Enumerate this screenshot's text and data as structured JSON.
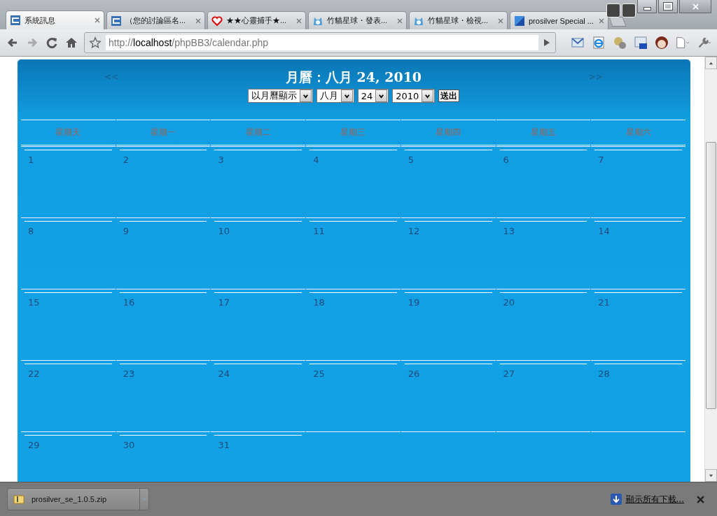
{
  "tabs": [
    {
      "title": "系統訊息",
      "selected": true
    },
    {
      "title": "（您的討論區名...",
      "selected": false
    },
    {
      "title": "★★心靈捕手★...",
      "selected": false
    },
    {
      "title": "竹貓星球・發表...",
      "selected": false
    },
    {
      "title": "竹貓星球・檢視...",
      "selected": false
    },
    {
      "title": "prosilver Special ...",
      "selected": false
    }
  ],
  "address": {
    "scheme": "http://",
    "host": "localhost",
    "path": "/phpBB3/calendar.php"
  },
  "calendar": {
    "prev": "<<",
    "next": ">>",
    "title": "月曆：八月 24, 2010",
    "selects": [
      {
        "value": "以月曆顯示"
      },
      {
        "value": "八月"
      },
      {
        "value": "24"
      },
      {
        "value": "2010"
      }
    ],
    "submit": "送出",
    "weekdays": [
      "星期天",
      "星期一",
      "星期二",
      "星期三",
      "星期四",
      "星期五",
      "星期六"
    ],
    "weeks": [
      [
        "1",
        "2",
        "3",
        "4",
        "5",
        "6",
        "7"
      ],
      [
        "8",
        "9",
        "10",
        "11",
        "12",
        "13",
        "14"
      ],
      [
        "15",
        "16",
        "17",
        "18",
        "19",
        "20",
        "21"
      ],
      [
        "22",
        "23",
        "24",
        "25",
        "26",
        "27",
        "28"
      ],
      [
        "29",
        "30",
        "31"
      ]
    ]
  },
  "download": {
    "file": "prosilver_se_1.0.5.zip",
    "show_all": "顯示所有下載..."
  }
}
